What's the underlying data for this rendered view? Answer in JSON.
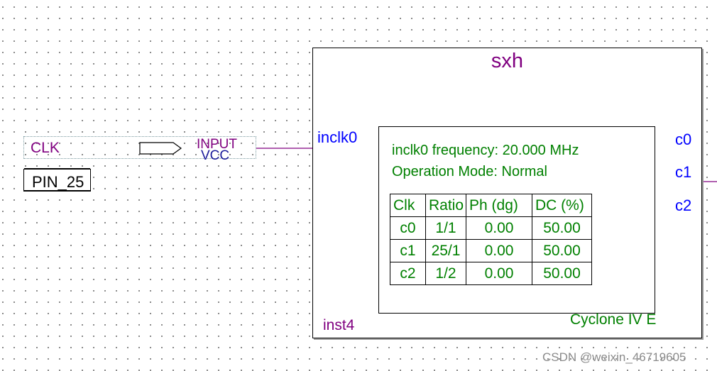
{
  "pin": {
    "name": "CLK",
    "type": "INPUT",
    "value": "VCC",
    "location": "PIN_25"
  },
  "block": {
    "title": "sxh",
    "instance": "inst4",
    "input_port": "inclk0",
    "output_ports": [
      "c0",
      "c1",
      "c2"
    ],
    "info_frequency": "inclk0 frequency: 20.000 MHz",
    "info_mode": "Operation Mode: Normal",
    "device": "Cyclone IV E"
  },
  "table": {
    "headers": [
      "Clk",
      "Ratio",
      "Ph (dg)",
      "DC (%)"
    ],
    "rows": [
      [
        "c0",
        "1/1",
        "0.00",
        "50.00"
      ],
      [
        "c1",
        "25/1",
        "0.00",
        "50.00"
      ],
      [
        "c2",
        "1/2",
        "0.00",
        "50.00"
      ]
    ]
  },
  "watermark": "CSDN @weixin_46719605",
  "colors": {
    "wire_purple": "#800080",
    "wire_teal": "#008080",
    "text_green": "#008000",
    "port_blue": "#0000ff"
  }
}
